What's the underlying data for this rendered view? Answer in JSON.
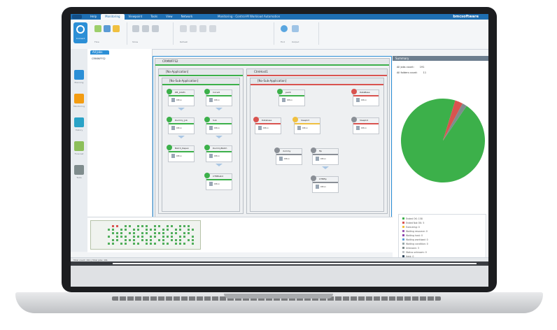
{
  "app": {
    "title": "Monitoring - Control-M Workload Automation",
    "brand": "bmcsoftware"
  },
  "tabs": [
    {
      "label": "Help"
    },
    {
      "label": "Monitoring"
    },
    {
      "label": "Viewpoint"
    },
    {
      "label": "Tools"
    },
    {
      "label": "View"
    },
    {
      "label": "Network"
    }
  ],
  "ribbon": {
    "connect_label": "Connect",
    "groups": [
      {
        "label": "Flow"
      },
      {
        "label": "Services"
      },
      {
        "label": "Hierarchy"
      },
      {
        "label": "Show"
      },
      {
        "label": "Refresh"
      },
      {
        "label": "Find"
      },
      {
        "label": "Output"
      }
    ]
  },
  "left_tools": [
    {
      "label": "Planning"
    },
    {
      "label": "Monitoring"
    },
    {
      "label": "History"
    },
    {
      "label": "Forecast"
    },
    {
      "label": "Tools"
    }
  ],
  "tree": {
    "tab": "All Jobs",
    "root": "CRMWFFS2"
  },
  "canvas": {
    "top_folder": "CRMWFFS2",
    "left_app": "[No-Application]",
    "left_sub": "[No-Sub-Application]",
    "right_app": "CtmHost1",
    "right_sub": "[No-Sub-Application]",
    "jobs_left": [
      {
        "name": "DB_Job#1",
        "sub": "DBxx"
      },
      {
        "name": "Dummy_Job",
        "sub": "DBxx"
      },
      {
        "name": "Batch_Depen",
        "sub": "DBxx"
      },
      {
        "name": "DummyBatch",
        "sub": "DBxx"
      },
      {
        "name": "Incredi",
        "sub": "DBxx"
      },
      {
        "name": "Sub",
        "sub": "DBxx"
      },
      {
        "name": "CTMBulkd",
        "sub": "DBxx"
      }
    ],
    "jobs_right": [
      {
        "name": "paint",
        "sub": "DBxx"
      },
      {
        "name": "DataBase",
        "sub": "DBxx"
      },
      {
        "name": "Database",
        "sub": "DBxx"
      },
      {
        "name": "Sleepk3",
        "sub": "DBxx"
      },
      {
        "name": "Sleepk4",
        "sub": "DBxx"
      },
      {
        "name": "dummy",
        "sub": "DBxx"
      },
      {
        "name": "ftp",
        "sub": "DBxx"
      },
      {
        "name": "CTMftp",
        "sub": "DBxx"
      }
    ]
  },
  "right_panel": {
    "header": "Summary",
    "stat1_label": "All jobs count:",
    "stat1_value": "191",
    "stat2_label": "All folders count:",
    "stat2_value": "11"
  },
  "chart_data": {
    "type": "pie",
    "categories": [
      "Ended OK",
      "Ended Not OK",
      "Executing",
      "Waiting resource",
      "Waiting host",
      "Waiting workload",
      "Waiting condition",
      "Unknown",
      "Status unknown",
      "Held"
    ],
    "values": [
      158,
      5,
      0,
      0,
      0,
      0,
      0,
      3,
      0,
      0
    ]
  },
  "legend": [
    {
      "text": "Ended OK: 158",
      "color": "#3cb04a"
    },
    {
      "text": "Ended Not OK: 5",
      "color": "#d9534f"
    },
    {
      "text": "Executing: 0",
      "color": "#f0c040"
    },
    {
      "text": "Waiting resource: 0",
      "color": "#9b59b6"
    },
    {
      "text": "Waiting host: 0",
      "color": "#8e44ad"
    },
    {
      "text": "Waiting workload: 0",
      "color": "#5b9bd5"
    },
    {
      "text": "Waiting condition: 0",
      "color": "#95a5a6"
    },
    {
      "text": "Unknown: 3",
      "color": "#7f8c8d"
    },
    {
      "text": "Status unknown: 0",
      "color": "#bdc3c7"
    },
    {
      "text": "Held: 0",
      "color": "#34495e"
    }
  ],
  "status": {
    "text": "Total count: 191 | Total jobs: 191"
  }
}
